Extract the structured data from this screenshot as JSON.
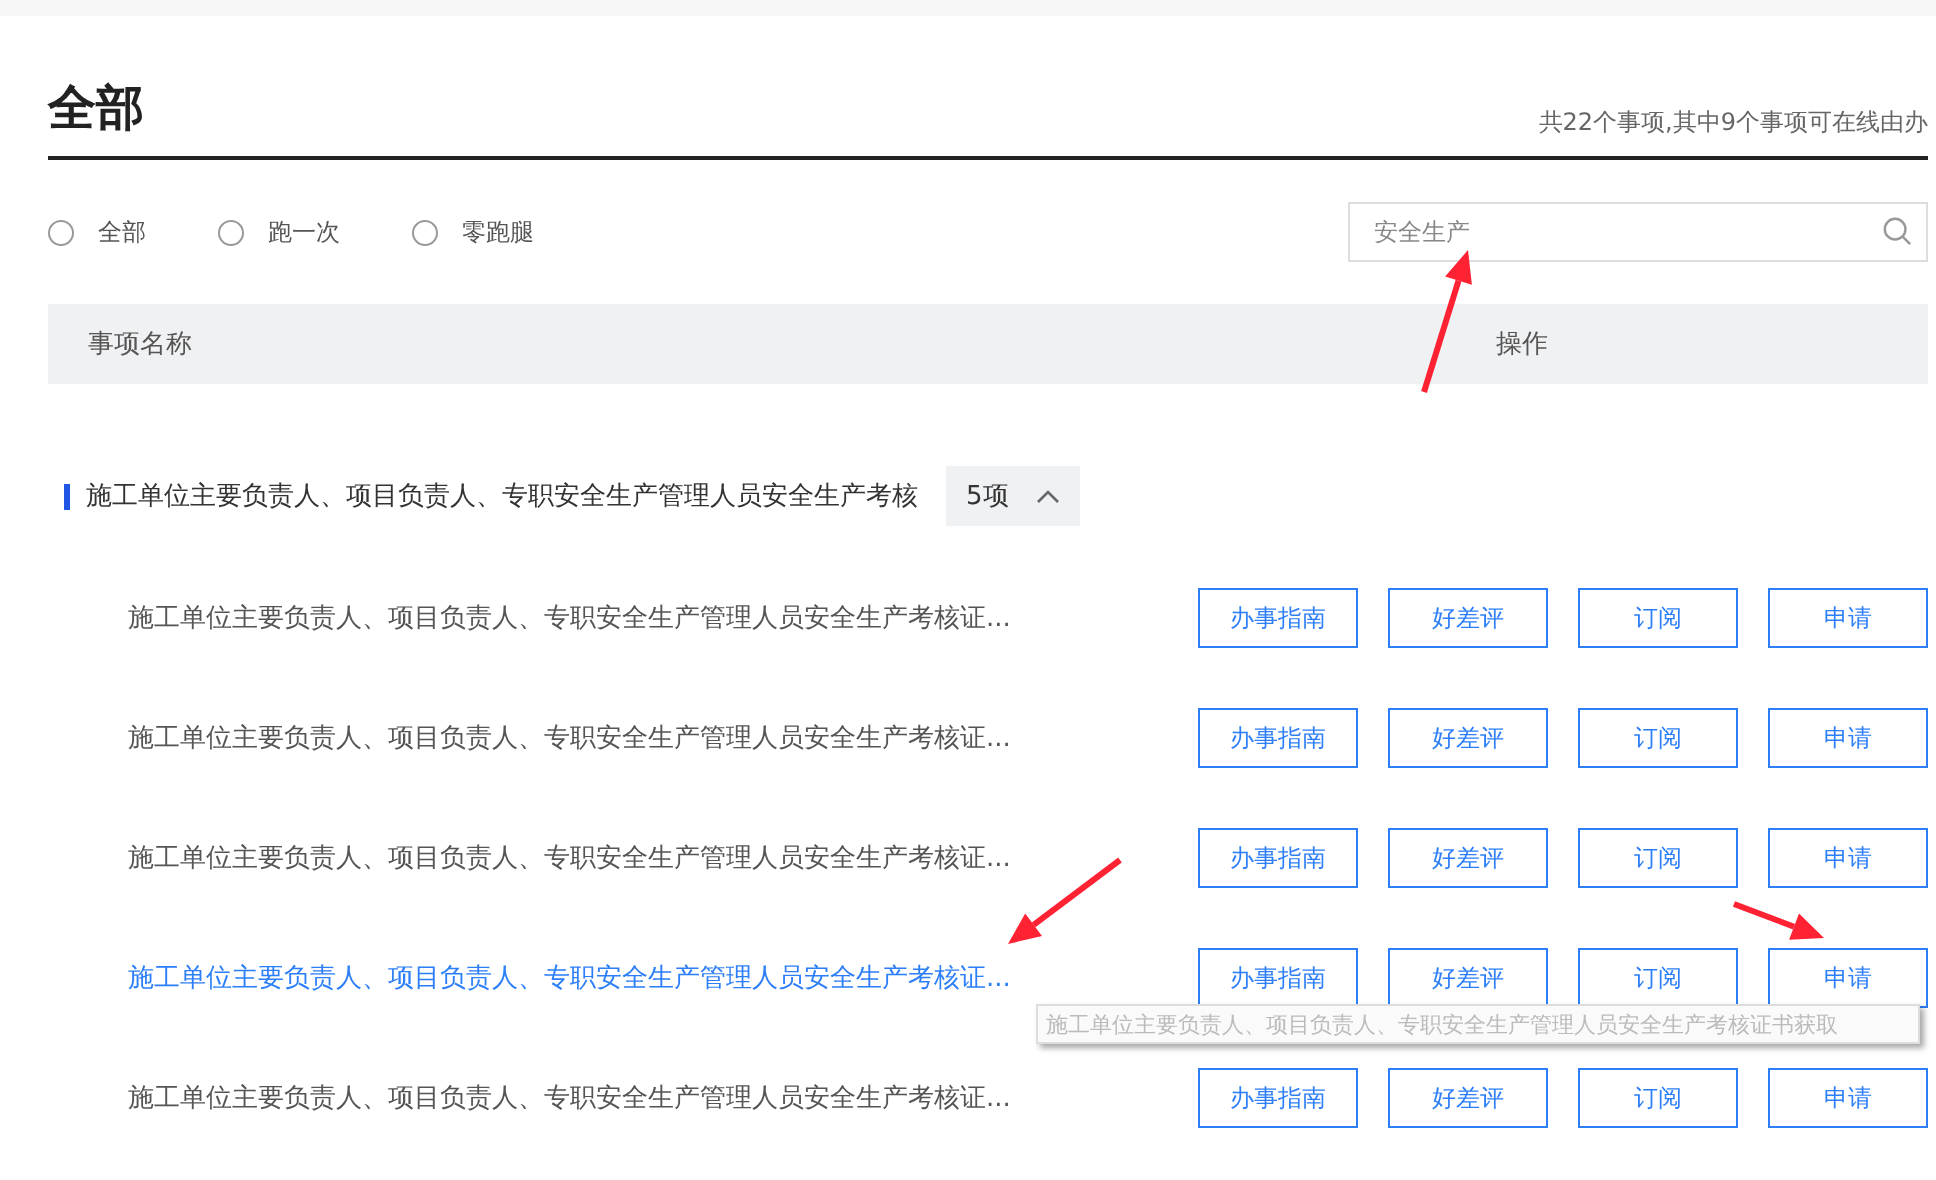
{
  "title": "全部",
  "summary": "共22个事项,其中9个事项可在线由办",
  "filters": [
    {
      "label": "全部",
      "selected": false
    },
    {
      "label": "跑一次",
      "selected": false
    },
    {
      "label": "零跑腿",
      "selected": false
    }
  ],
  "search": {
    "value": "安全生产"
  },
  "table": {
    "columns": [
      "事项名称",
      "操作"
    ]
  },
  "group": {
    "title": "施工单位主要负责人、项目负责人、专职安全生产管理人员安全生产考核",
    "count": "5项",
    "expanded": true,
    "items": [
      {
        "name": "施工单位主要负责人、项目负责人、专职安全生产管理人员安全生产考核证...",
        "hovered": false,
        "actions": [
          "办事指南",
          "好差评",
          "订阅",
          "申请"
        ]
      },
      {
        "name": "施工单位主要负责人、项目负责人、专职安全生产管理人员安全生产考核证...",
        "hovered": false,
        "actions": [
          "办事指南",
          "好差评",
          "订阅",
          "申请"
        ]
      },
      {
        "name": "施工单位主要负责人、项目负责人、专职安全生产管理人员安全生产考核证...",
        "hovered": false,
        "actions": [
          "办事指南",
          "好差评",
          "订阅",
          "申请"
        ]
      },
      {
        "name": "施工单位主要负责人、项目负责人、专职安全生产管理人员安全生产考核证...",
        "hovered": true,
        "actions": [
          "办事指南",
          "好差评",
          "订阅",
          "申请"
        ]
      },
      {
        "name": "施工单位主要负责人、项目负责人、专职安全生产管理人员安全生产考核证...",
        "hovered": false,
        "actions": [
          "办事指南",
          "好差评",
          "订阅",
          "申请"
        ]
      }
    ]
  },
  "tooltip": "施工单位主要负责人、项目负责人、专职安全生产管理人员安全生产考核证书获取"
}
